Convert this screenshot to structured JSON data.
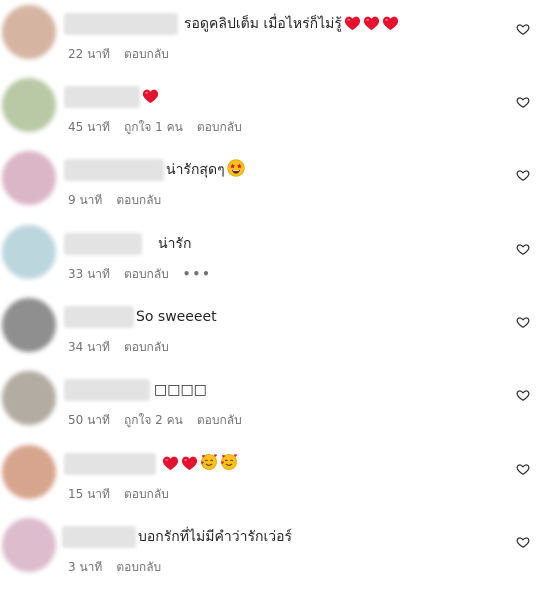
{
  "comments": [
    {
      "text": "รอดูคลิปเต็ม เมื่อไหร่ก็ไม่รู้",
      "emojis": [
        "red-heart",
        "red-heart",
        "red-heart"
      ],
      "time": "22 นาที",
      "likes": "",
      "reply": "ตอบกลับ",
      "more": ""
    },
    {
      "text": "",
      "emojis": [
        "red-heart"
      ],
      "time": "45 นาที",
      "likes": "ถูกใจ 1 คน",
      "reply": "ตอบกลับ",
      "more": ""
    },
    {
      "text": "น่ารักสุดๆ",
      "emojis": [
        "star-struck"
      ],
      "time": "9 นาที",
      "likes": "",
      "reply": "ตอบกลับ",
      "more": ""
    },
    {
      "text": "น่ารัก",
      "emojis": [],
      "time": "33 นาที",
      "likes": "",
      "reply": "ตอบกลับ",
      "more": "•••"
    },
    {
      "text": "So sweeeet",
      "emojis": [],
      "time": "34 นาที",
      "likes": "",
      "reply": "ตอบกลับ",
      "more": ""
    },
    {
      "text": "□□□□",
      "emojis": [],
      "time": "50 นาที",
      "likes": "ถูกใจ 2 คน",
      "reply": "ตอบกลับ",
      "more": ""
    },
    {
      "text": "",
      "emojis": [
        "red-heart",
        "red-heart",
        "smiling-hearts",
        "smiling-hearts"
      ],
      "time": "15 นาที",
      "likes": "",
      "reply": "ตอบกลับ",
      "more": ""
    },
    {
      "text": "บอกรักที่ไม่มีคำว่ารักเว่อร์",
      "emojis": [],
      "time": "3 นาที",
      "likes": "",
      "reply": "ตอบกลับ",
      "more": ""
    }
  ],
  "icons": {
    "like": "heart-outline-icon"
  },
  "colors": {
    "text": "#262626",
    "meta": "#737373",
    "heart": "#e4112f"
  }
}
